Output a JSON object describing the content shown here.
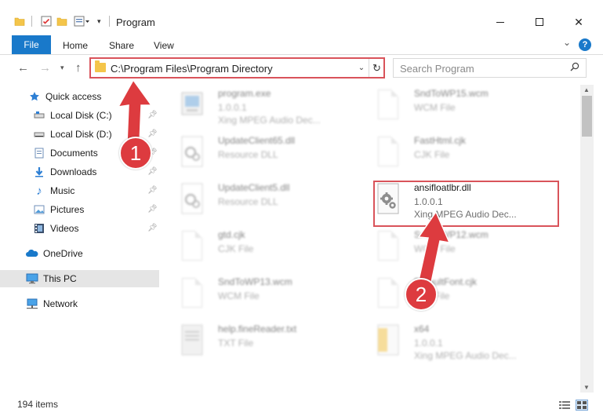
{
  "window": {
    "title": "Program",
    "minimize": "─",
    "maximize": "☐",
    "close": "✕"
  },
  "ribbon": {
    "tabs": [
      "File",
      "Home",
      "Share",
      "View"
    ],
    "help": "?"
  },
  "nav": {
    "address": "C:\\Program Files\\Program Directory",
    "search_placeholder": "Search Program"
  },
  "sidebar": {
    "items": [
      {
        "label": "Quick access",
        "icon": "star-icon",
        "pinned": false
      },
      {
        "label": "Local Disk (C:)",
        "icon": "drive-icon",
        "pinned": true
      },
      {
        "label": "Local Disk (D:)",
        "icon": "drive-icon",
        "pinned": true
      },
      {
        "label": "Documents",
        "icon": "documents-icon",
        "pinned": true
      },
      {
        "label": "Downloads",
        "icon": "downloads-icon",
        "pinned": true
      },
      {
        "label": "Music",
        "icon": "music-icon",
        "pinned": true
      },
      {
        "label": "Pictures",
        "icon": "pictures-icon",
        "pinned": true
      },
      {
        "label": "Videos",
        "icon": "videos-icon",
        "pinned": true
      },
      {
        "label": "OneDrive",
        "icon": "onedrive-icon",
        "pinned": false
      },
      {
        "label": "This PC",
        "icon": "computer-icon",
        "pinned": false,
        "selected": true
      },
      {
        "label": "Network",
        "icon": "network-icon",
        "pinned": false
      }
    ]
  },
  "files": [
    {
      "name": "program.exe",
      "line2": "1.0.0.1",
      "line3": "Xing MPEG Audio Dec...",
      "icon": "exe-icon",
      "blurred": true
    },
    {
      "name": "SndToWP15.wcm",
      "line2": "WCM File",
      "line3": "",
      "icon": "document-icon",
      "blurred": true
    },
    {
      "name": "UpdateClient65.dll",
      "line2": "Resource DLL",
      "line3": "",
      "icon": "dll-icon",
      "blurred": true
    },
    {
      "name": "FastHtml.cjk",
      "line2": "CJK File",
      "line3": "",
      "icon": "document-icon",
      "blurred": true
    },
    {
      "name": "UpdateClient5.dll",
      "line2": "Resource DLL",
      "line3": "",
      "icon": "dll-icon",
      "blurred": true
    },
    {
      "name": "ansifloatlbr.dll",
      "line2": "1.0.0.1",
      "line3": "Xing MPEG Audio Dec...",
      "icon": "dll-gear-icon",
      "blurred": false,
      "highlighted": true
    },
    {
      "name": "gtd.cjk",
      "line2": "CJK File",
      "line3": "",
      "icon": "document-icon",
      "blurred": true
    },
    {
      "name": "SndToWP12.wcm",
      "line2": "WCM File",
      "line3": "",
      "icon": "document-icon",
      "blurred": true
    },
    {
      "name": "SndToWP13.wcm",
      "line2": "WCM File",
      "line3": "",
      "icon": "document-icon",
      "blurred": true
    },
    {
      "name": "DefaultFont.cjk",
      "line2": "CJK File",
      "line3": "",
      "icon": "document-icon",
      "blurred": true
    },
    {
      "name": "help.fineReader.txt",
      "line2": "TXT File",
      "line3": "",
      "icon": "text-icon",
      "blurred": true
    },
    {
      "name": "x64",
      "line2": "1.0.0.1",
      "line3": "Xing MPEG Audio Dec...",
      "icon": "folder-icon",
      "blurred": true
    }
  ],
  "status": {
    "item_count": "194 items"
  },
  "annotations": [
    {
      "number": "1",
      "color": "#dd3b3f"
    },
    {
      "number": "2",
      "color": "#dd3b3f"
    }
  ],
  "colors": {
    "accent": "#1979ca",
    "highlight_box": "#d9535a",
    "selected_bg": "#e5e5e5"
  }
}
